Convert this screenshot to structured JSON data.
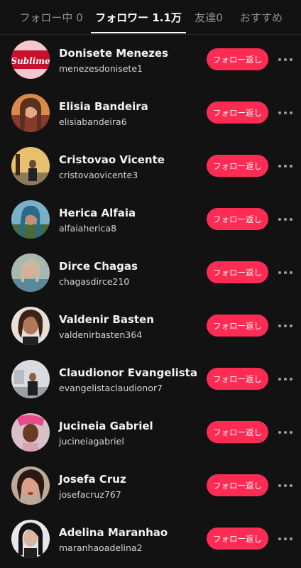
{
  "tabs": [
    {
      "label": "フォロー中 0",
      "active": false
    },
    {
      "label": "フォロワー 1.1万",
      "active": true
    },
    {
      "label": "友達0",
      "active": false
    },
    {
      "label": "おすすめ",
      "active": false
    }
  ],
  "colors": {
    "background": "#121212",
    "accent": "#fe2c55",
    "text_primary": "#ffffff",
    "text_secondary": "#8f8f8f"
  },
  "followers": [
    {
      "name": "Donisete Menezes",
      "handle": "menezesdonisete1",
      "button": "フォロー返し",
      "avatar_text": "Sublime"
    },
    {
      "name": "Elisia Bandeira",
      "handle": "elisiabandeira6",
      "button": "フォロー返し"
    },
    {
      "name": "Cristovao Vicente",
      "handle": "cristovaovicente3",
      "button": "フォロー返し"
    },
    {
      "name": "Herica Alfaia",
      "handle": "alfaiaherica8",
      "button": "フォロー返し"
    },
    {
      "name": "Dirce Chagas",
      "handle": "chagasdirce210",
      "button": "フォロー返し"
    },
    {
      "name": "Valdenir Basten",
      "handle": "valdenirbasten364",
      "button": "フォロー返し"
    },
    {
      "name": "Claudionor Evangelista",
      "handle": "evangelistaclaudionor7",
      "button": "フォロー返し"
    },
    {
      "name": "Jucineia Gabriel",
      "handle": "jucineiagabriel",
      "button": "フォロー返し"
    },
    {
      "name": "Josefa Cruz",
      "handle": "josefacruz767",
      "button": "フォロー返し"
    },
    {
      "name": "Adelina Maranhao",
      "handle": "maranhaoadelina2",
      "button": "フォロー返し"
    }
  ]
}
